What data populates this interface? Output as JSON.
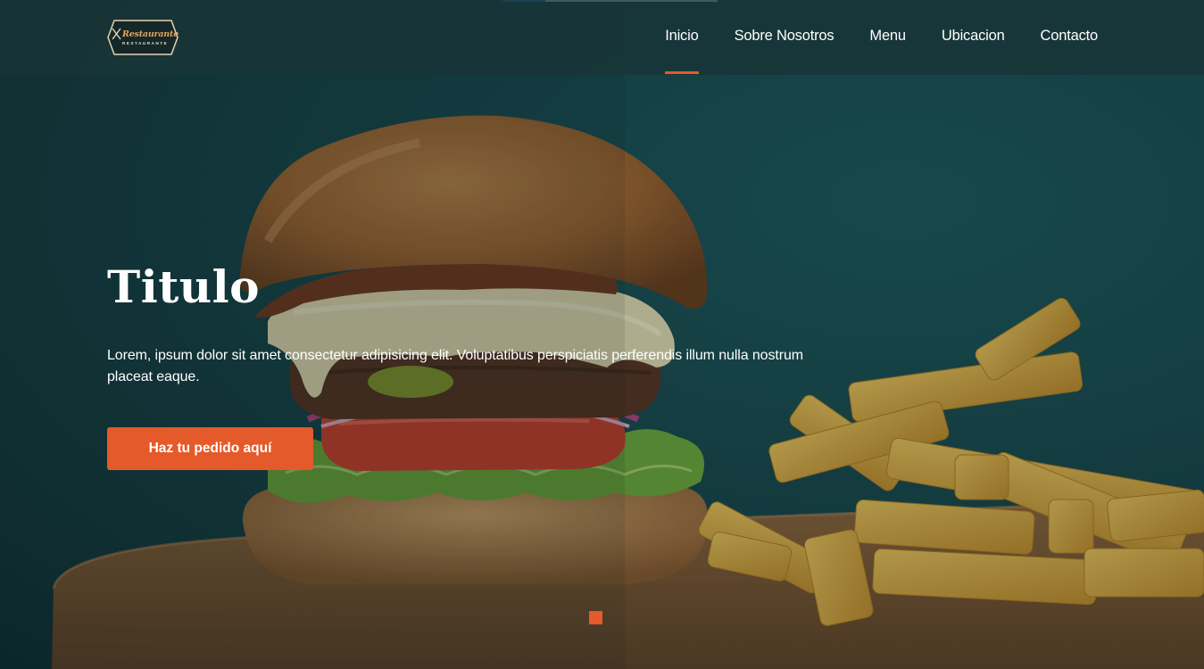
{
  "brand": {
    "logo_title": "Restaurante",
    "logo_subtitle": "RESTAURANTE",
    "accent_color": "#e45a2a"
  },
  "nav": {
    "items": [
      {
        "label": "Inicio",
        "active": true
      },
      {
        "label": "Sobre Nosotros",
        "active": false
      },
      {
        "label": "Menu",
        "active": false
      },
      {
        "label": "Ubicacion",
        "active": false
      },
      {
        "label": "Contacto",
        "active": false
      }
    ]
  },
  "hero": {
    "title": "Titulo",
    "text": "Lorem, ipsum dolor sit amet consectetur adipisicing elit. Voluptatibus perspiciatis perferendis illum nulla nostrum placeat eaque.",
    "cta_label": "Haz tu pedido aquí",
    "image": "burger-and-fries-photo",
    "slides_count": 1,
    "active_slide": 1
  }
}
